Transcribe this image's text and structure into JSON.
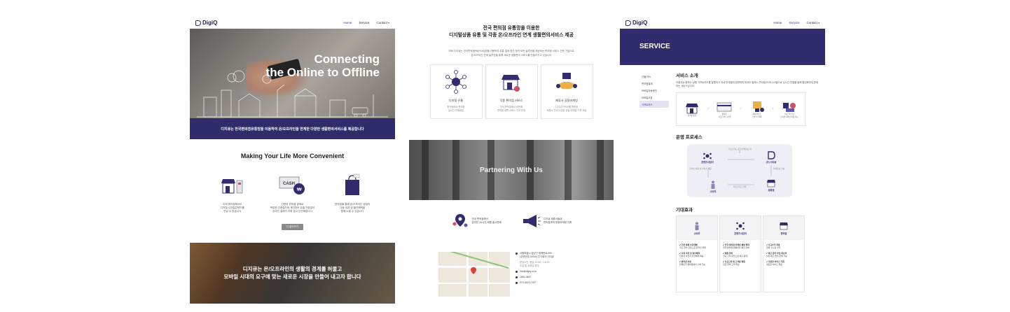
{
  "brand": {
    "name": "DigiQ",
    "color": "#312c6e"
  },
  "nav": {
    "home": "Home",
    "service": "Service",
    "contact": "Contact",
    "drop_arrow": "▾"
  },
  "page1": {
    "hero": {
      "title_line1": "Connecting",
      "title_line2": "the Online to Offline",
      "band": "디지큐는 전국편의점유통망을 이용하여 온/오프라인을 연계한 다양한 생활편의서비스를 제공합니다"
    },
    "section_title": "Making Your Life More Convenient",
    "features": [
      {
        "icon": "store-icon",
        "line1": "이제 편의점에서도",
        "line2": "디지털 디지털콘텐츠를",
        "line3": "만날 수 있습니다"
      },
      {
        "icon": "cash-icon",
        "line1": "간편한 편의점 결제로",
        "line2": "복잡한 인증절차와 개인정보 유출 걱정없이",
        "line3": "온라인 결제가 더욱 쉽고 안전해집니다"
      },
      {
        "icon": "shopping-bag-icon",
        "line1": "편의점을 통해 온/오프라인 상점의",
        "line2": "다종 쿠폰 및 할인혜택을",
        "line3": "함께 누릴 수 있습니다"
      }
    ],
    "more_button": "더 알아보기",
    "bottom": {
      "line1": "디지큐는 온/오프라인의 생활의 경계를 허물고",
      "line2": "모바일 시대의 요구에 맞는 새로운 시장을 만들어 내고자 합니다"
    }
  },
  "page2": {
    "title_line1": "전국 편의점 유통망을 이용한",
    "title_line2": "디지털상품 유통 및 각종 온/오프라인 연계 생활편의서비스 제공",
    "desc": "저희 디지큐는 전국편의점PB(POS)망을 이용하여 유통 결제 정산 등의 모든 솔루션을 제공하는 편의점 서비스 전문 기업으로 온/오프라인 연계 솔루션을 통해 새로운 생활편의 서비스를 만들어가고 있습니다",
    "cards": [
      {
        "icon": "network-icon",
        "name": "디지털 유통",
        "sub1": "편의점에서 편리한",
        "sub2": "실시간 판매제공"
      },
      {
        "icon": "store-icon",
        "name": "각종 편의점 서비스",
        "sub1": "전국 편의점에서 한번에",
        "sub2": "편의점 생활 서비스 기획 운영"
      },
      {
        "icon": "partnership-icon",
        "name": "제휴사 공동마케팅",
        "sub1": "디지큐 인프라를 활용한",
        "sub2": "제휴사 간의 다양한 공동 마케팅 기획 제공"
      }
    ],
    "partner_title": "Partnering With Us",
    "stats": [
      {
        "icon": "map-pin-icon",
        "line1": "전국 편의점에서",
        "line2": "온라인 24시간 제품 출시판매"
      },
      {
        "icon": "megaphone-icon",
        "line1": "디지큐 제휴사들과",
        "line2": "편의점과의 공동마케팅 기획"
      }
    ],
    "contact": {
      "address1": "서울특별시 강남구 테헤란로 000",
      "address2": "(우편번호 00000) 주식회사 디지큐",
      "hours1": "운영시간: 평일 10:00 ~ 18:00",
      "hours2": "주말 및 공휴일 휴무",
      "email": "info@digiq.co.kr",
      "phone": "1661-0867",
      "fax": "070-4622-0787"
    }
  },
  "page3": {
    "banner": "SERVICE",
    "side": [
      "선물 PIN",
      "편의점결제",
      "모바일자동충전",
      "모바일쿠폰",
      "기프트카드"
    ],
    "active_side": 4,
    "intro_title": "서비스 소개",
    "intro_text": "이용자는 원하는 상품 기프트카드를 발행하고 국내 편의점에 방문하여 바코드 결제시 편의점 POS시스템으로 실시간 연결을 통해 활성화하여 판매하는 서비스입니다.",
    "flow": [
      {
        "line1": "편의점 방문",
        "line2": ""
      },
      {
        "line1": "원하는",
        "line2": "기프트카드 선택"
      },
      {
        "line1": "결제 바코드",
        "line2": "스캔 후 결제"
      },
      {
        "line1": "바로 적립 및",
        "line2": "온라인 서비스이용 가능"
      }
    ],
    "process_title": "운영 프로세스",
    "process": {
      "company": "콘텐츠사업자",
      "digiq": "(주) 디지큐",
      "consumer": "소비자",
      "store": "유통점",
      "note_top": "기프트카드 공급/판매정보 제공",
      "note_left": "콘텐츠 이용 및 서비스 제공",
      "note_right": "판매정보 전송",
      "note_bottom": "기프트카드 판매"
    },
    "effect_title": "기대효과",
    "effects": [
      {
        "label": "소비자",
        "items": [
          {
            "t": "기존 결제 수단대체",
            "d": "카드 없이 현금으로 온라인 결제"
          },
          {
            "t": "다종 쿠폰 및 할인혜택",
            "d": "다양한 쿠폰과 할인혜택 제공"
          },
          {
            "t": "편리한 사용",
            "d": "언제든지 편의점에서 구매 가능"
          }
        ]
      },
      {
        "label": "콘텐츠사업자",
        "items": [
          {
            "t": "전국 편의점 마케팅 채널 확대",
            "d": "전국 편의점 유통망을 통한 판매"
          },
          {
            "t": "매출 향상",
            "d": "신규 고객 유입으로 매출 증대"
          },
          {
            "t": "신규고객 및 고객층 확대",
            "d": "현금 결제 고객 확보"
          }
        ]
      },
      {
        "label": "편의점",
        "items": [
          {
            "t": "신규수익 창출",
            "d": "판매 수수료 수익"
          },
          {
            "t": "재고 관리 부담 최소화",
            "d": "실물 재고 없이 판매 가능"
          },
          {
            "t": "다양한 서비스 기회",
            "d": "새로운 서비스 제공"
          }
        ]
      }
    ]
  }
}
